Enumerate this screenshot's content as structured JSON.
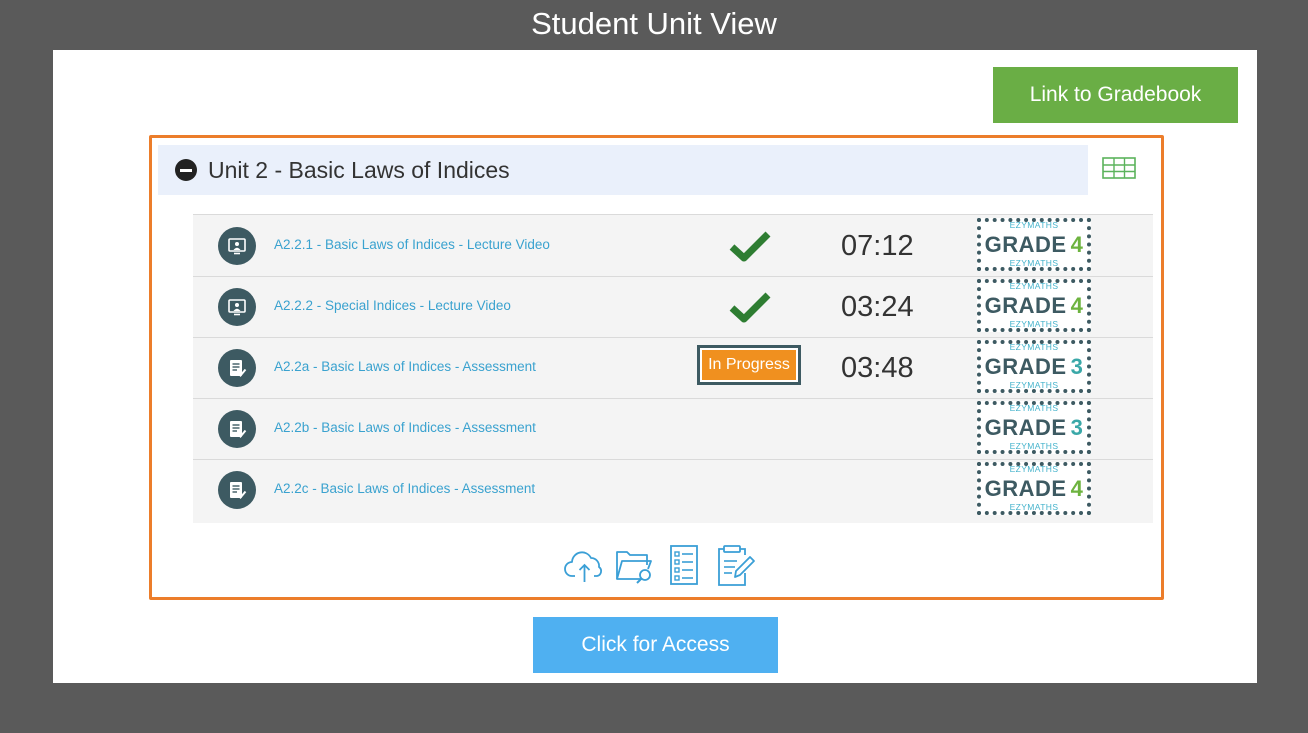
{
  "page": {
    "title": "Student Unit View"
  },
  "gradebook_button": {
    "label": "Link to Gradebook"
  },
  "unit": {
    "title": "Unit 2 - Basic Laws of Indices",
    "items": [
      {
        "icon": "video-lecture-icon",
        "label": "A2.2.1 - Basic Laws of Indices - Lecture Video",
        "status": "complete",
        "time": "07:12",
        "grade_brand": "EZYMATHS",
        "grade_label": "GRADE",
        "grade_number": "4"
      },
      {
        "icon": "video-lecture-icon",
        "label": "A2.2.2 - Special Indices - Lecture Video",
        "status": "complete",
        "time": "03:24",
        "grade_brand": "EZYMATHS",
        "grade_label": "GRADE",
        "grade_number": "4"
      },
      {
        "icon": "assessment-icon",
        "label": "A2.2a - Basic Laws of Indices - Assessment",
        "status": "In Progress",
        "time": "03:48",
        "grade_brand": "EZYMATHS",
        "grade_label": "GRADE",
        "grade_number": "3"
      },
      {
        "icon": "assessment-icon",
        "label": "A2.2b - Basic Laws of Indices - Assessment",
        "status": "",
        "time": "",
        "grade_brand": "EZYMATHS",
        "grade_label": "GRADE",
        "grade_number": "3"
      },
      {
        "icon": "assessment-icon",
        "label": "A2.2c - Basic Laws of Indices - Assessment",
        "status": "",
        "time": "",
        "grade_brand": "EZYMATHS",
        "grade_label": "GRADE",
        "grade_number": "4"
      }
    ],
    "tools": [
      "cloud-upload-icon",
      "folder-search-icon",
      "checklist-icon",
      "clipboard-edit-icon"
    ]
  },
  "access_button": {
    "label": "Click for Access"
  },
  "colors": {
    "frame": "#5a5a5a",
    "gradebook_button": "#6aae45",
    "unit_border": "#ec7d2a",
    "header_bg": "#eaf0fb",
    "link": "#3aa2cf",
    "check": "#2e7d32",
    "in_progress": "#f0901f",
    "grade_badge": "#3d5a62",
    "grade_3": "#3aa8a8",
    "grade_4": "#6db33f",
    "access_button": "#4fb0f1"
  }
}
